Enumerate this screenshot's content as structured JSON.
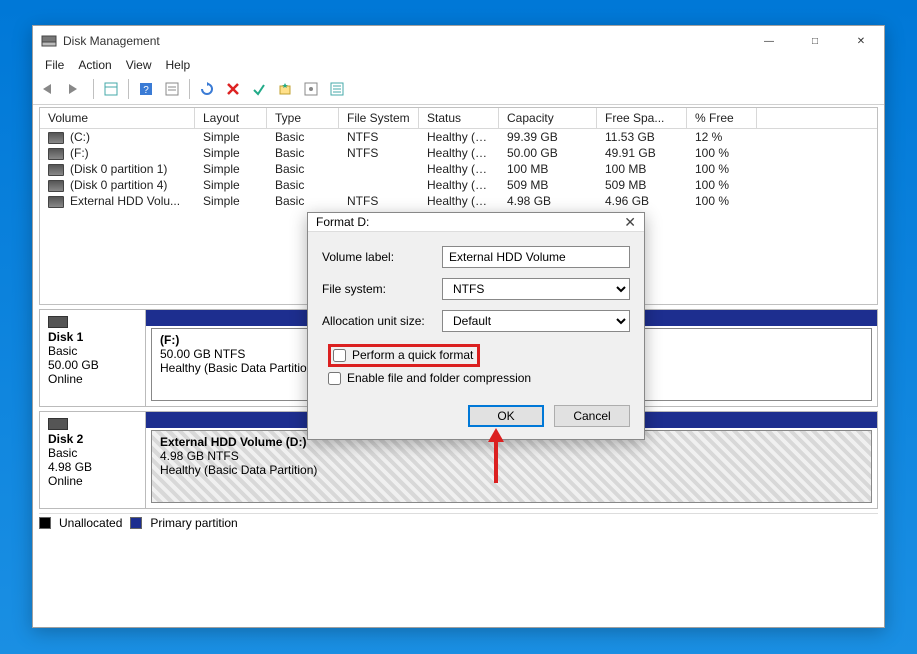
{
  "window": {
    "title": "Disk Management",
    "menus": [
      "File",
      "Action",
      "View",
      "Help"
    ]
  },
  "volumes": {
    "headers": {
      "volume": "Volume",
      "layout": "Layout",
      "type": "Type",
      "fs": "File System",
      "status": "Status",
      "cap": "Capacity",
      "free": "Free Spa...",
      "pfree": "% Free"
    },
    "rows": [
      {
        "volume": "(C:)",
        "layout": "Simple",
        "type": "Basic",
        "fs": "NTFS",
        "status": "Healthy (B...",
        "cap": "99.39 GB",
        "free": "11.53 GB",
        "pfree": "12 %"
      },
      {
        "volume": "(F:)",
        "layout": "Simple",
        "type": "Basic",
        "fs": "NTFS",
        "status": "Healthy (B...",
        "cap": "50.00 GB",
        "free": "49.91 GB",
        "pfree": "100 %"
      },
      {
        "volume": "(Disk 0 partition 1)",
        "layout": "Simple",
        "type": "Basic",
        "fs": "",
        "status": "Healthy (E...",
        "cap": "100 MB",
        "free": "100 MB",
        "pfree": "100 %"
      },
      {
        "volume": "(Disk 0 partition 4)",
        "layout": "Simple",
        "type": "Basic",
        "fs": "",
        "status": "Healthy (R...",
        "cap": "509 MB",
        "free": "509 MB",
        "pfree": "100 %"
      },
      {
        "volume": "External HDD Volu...",
        "layout": "Simple",
        "type": "Basic",
        "fs": "NTFS",
        "status": "Healthy (B...",
        "cap": "4.98 GB",
        "free": "4.96 GB",
        "pfree": "100 %"
      }
    ]
  },
  "disks": [
    {
      "name": "Disk 1",
      "type": "Basic",
      "size": "50.00 GB",
      "status": "Online",
      "partition": {
        "title": "(F:)",
        "line2": "50.00 GB NTFS",
        "line3": "Healthy (Basic Data Partition)"
      }
    },
    {
      "name": "Disk 2",
      "type": "Basic",
      "size": "4.98 GB",
      "status": "Online",
      "partition": {
        "title": "External HDD Volume  (D:)",
        "line2": "4.98 GB NTFS",
        "line3": "Healthy (Basic Data Partition)"
      }
    }
  ],
  "legend": {
    "unalloc": "Unallocated",
    "primary": "Primary partition"
  },
  "dialog": {
    "title": "Format D:",
    "vol_label_lbl": "Volume label:",
    "vol_label_val": "External HDD Volume",
    "fs_lbl": "File system:",
    "fs_val": "NTFS",
    "aus_lbl": "Allocation unit size:",
    "aus_val": "Default",
    "quick_format": "Perform a quick format",
    "enable_compression": "Enable file and folder compression",
    "ok": "OK",
    "cancel": "Cancel"
  }
}
